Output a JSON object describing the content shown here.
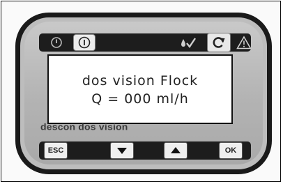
{
  "display": {
    "line1": "dos vision Flock",
    "line2": "Q = 000 ml/h"
  },
  "brand": {
    "text": "descon dos vision"
  },
  "top_icons": {
    "power": "power-icon",
    "info": "info-icon",
    "drop_check": "drop-check-icon",
    "refresh": "refresh-icon",
    "warning": "warning-icon"
  },
  "buttons": {
    "esc_label": "ESC",
    "down_icon": "arrow-down-icon",
    "up_icon": "arrow-up-icon",
    "ok_label": "OK"
  },
  "colors": {
    "panel": "#b3b3b3",
    "strip": "#1d1d1d",
    "key": "#efefef",
    "lcd_background": "#ffffff",
    "text": "#222222"
  }
}
